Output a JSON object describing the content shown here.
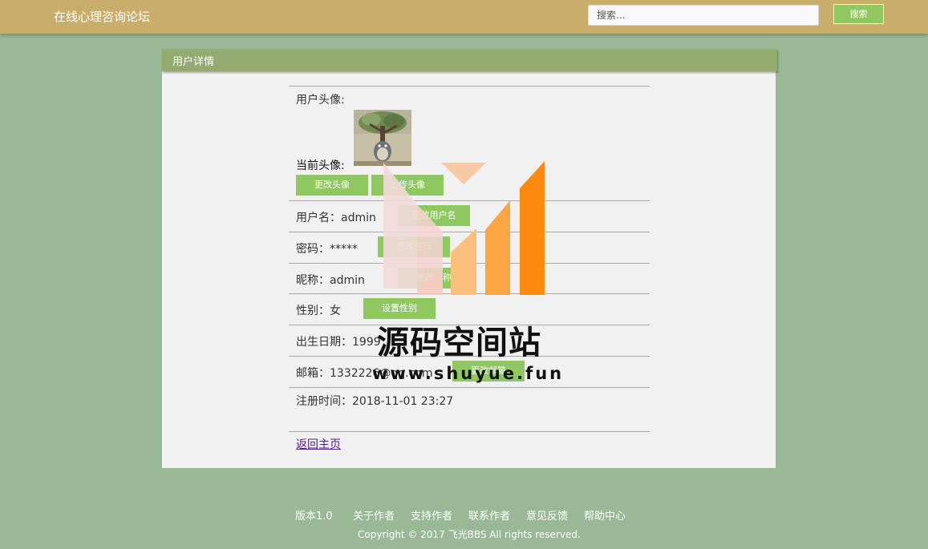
{
  "header": {
    "site_title": "在线心理咨询论坛",
    "search_placeholder": "搜索...",
    "search_button": "搜索"
  },
  "panel": {
    "title": "用户详情"
  },
  "profile": {
    "avatar_label": "用户头像:",
    "current_avatar_label": "当前头像:",
    "change_avatar": "更改头像",
    "upload_avatar": "上传头像",
    "username": "用户名：admin",
    "change_username": "更改用户名",
    "password": "密码：*****",
    "change_password": "更改密码",
    "nickname": "昵称：admin",
    "change_nickname": "更改昵称",
    "gender": "性别：女",
    "set_gender": "设置性别",
    "birthday": "出生日期：1999",
    "email": "邮箱：1332226@qq.com",
    "change_email": "更改邮箱",
    "register_time": "注册时间：2018-11-01 23:27",
    "back_home": "返回主页"
  },
  "footer": {
    "links": [
      "版本1.0",
      "关于作者",
      "支持作者",
      "联系作者",
      "意见反馈",
      "帮助中心"
    ],
    "copyright": "Copyright © 2017 飞光BBS All rights reserved."
  },
  "watermark": {
    "title": "源码空间站",
    "url": "www.shuyue.fun"
  },
  "colors": {
    "header": "#c9ad6a",
    "background": "#98b896",
    "accent_button": "#8ec85f",
    "panel_header": "#92ac70"
  }
}
